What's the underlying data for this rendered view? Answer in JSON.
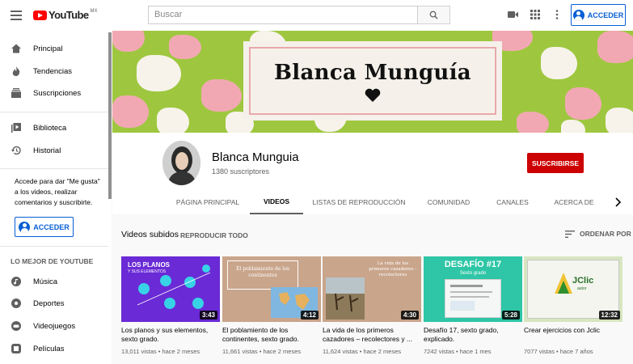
{
  "header": {
    "logo_text": "YouTube",
    "logo_country": "MX",
    "search_placeholder": "Buscar",
    "signin_label": "ACCEDER"
  },
  "sidebar": {
    "items": [
      {
        "label": "Principal",
        "icon": "home-icon"
      },
      {
        "label": "Tendencias",
        "icon": "trending-icon"
      },
      {
        "label": "Suscripciones",
        "icon": "subscriptions-icon"
      },
      {
        "label": "Biblioteca",
        "icon": "library-icon"
      },
      {
        "label": "Historial",
        "icon": "history-icon"
      }
    ],
    "signin_prompt": "Accede para dar \"Me gusta\" a los videos, realizar comentarios y suscribirte.",
    "signin_label": "ACCEDER",
    "best_heading": "LO MEJOR DE YOUTUBE",
    "best_items": [
      {
        "label": "Música",
        "icon": "music-icon"
      },
      {
        "label": "Deportes",
        "icon": "sports-icon"
      },
      {
        "label": "Videojuegos",
        "icon": "gaming-icon"
      },
      {
        "label": "Películas",
        "icon": "movies-icon"
      }
    ]
  },
  "channel": {
    "banner_title": "Blanca Munguía",
    "name": "Blanca Munguia",
    "subscribers": "1380 suscriptores",
    "subscribe_label": "SUSCRIBIRSE",
    "tabs": [
      "PÁGINA PRINCIPAL",
      "VIDEOS",
      "LISTAS DE REPRODUCCIÓN",
      "COMUNIDAD",
      "CANALES",
      "ACERCA DE"
    ],
    "active_tab": "VIDEOS"
  },
  "videos_section": {
    "heading": "Videos subidos",
    "play_all": "REPRODUCIR TODO",
    "sort_label": "ORDENAR POR"
  },
  "videos": [
    {
      "title": "Los planos y sus elementos, sexto grado.",
      "views": "13,011 vistas",
      "age": "hace 2 meses",
      "duration": "3:43",
      "thumb_text": "LOS PLANOS",
      "thumb_sub": "Y SUS ELEMENTOS"
    },
    {
      "title": "El poblamiento de los continentes, sexto grado.",
      "views": "11,661 vistas",
      "age": "hace 2 meses",
      "duration": "4:12",
      "thumb_text": "El poblamiento de los continentes",
      "thumb_sub": ""
    },
    {
      "title": "La vida de los primeros cazadores – recolectores y ...",
      "views": "11,624 vistas",
      "age": "hace 2 meses",
      "duration": "4:30",
      "thumb_text": "La vida de los primeros cazadores – recolectores",
      "thumb_sub": ""
    },
    {
      "title": "Desafío 17, sexto grado, explicado.",
      "views": "7242 vistas",
      "age": "hace 1 mes",
      "duration": "5:28",
      "thumb_text": "DESAFÍO #17",
      "thumb_sub": "Sexto grado"
    },
    {
      "title": "Crear ejercicios con Jclic",
      "views": "7077 vistas",
      "age": "hace 7 años",
      "duration": "12:32",
      "thumb_text": "JClic",
      "thumb_sub": "autor"
    }
  ],
  "colors": {
    "brand_red": "#ff0000",
    "subscribe_red": "#cc0000",
    "link_blue": "#065fd4",
    "banner_green": "#9ec73f",
    "banner_pink": "#e9a8ab"
  }
}
